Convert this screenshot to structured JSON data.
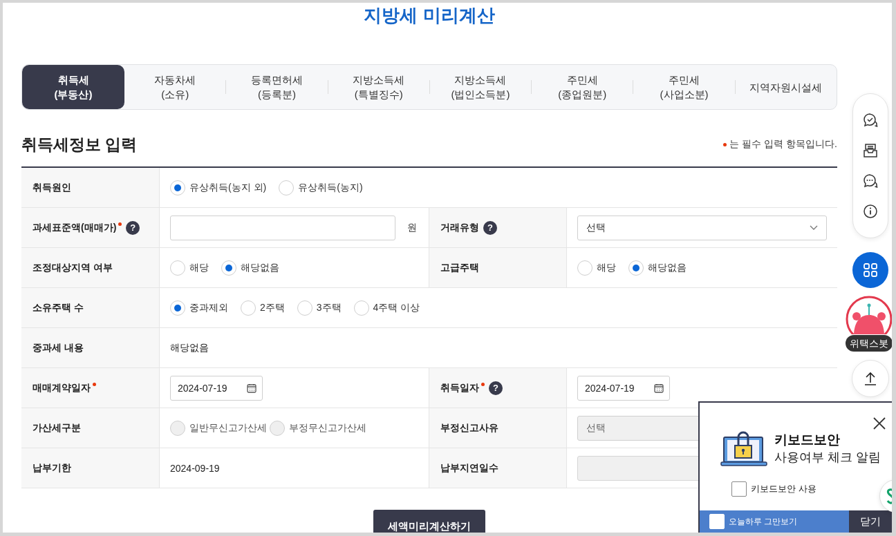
{
  "title": "지방세 미리계산",
  "tabs": [
    {
      "label": "취득세\n(부동산)",
      "selected": true
    },
    {
      "label": "자동차세\n(소유)",
      "selected": false
    },
    {
      "label": "등록면허세\n(등록분)",
      "selected": false
    },
    {
      "label": "지방소득세\n(특별징수)",
      "selected": false
    },
    {
      "label": "지방소득세\n(법인소득분)",
      "selected": false
    },
    {
      "label": "주민세\n(종업원분)",
      "selected": false
    },
    {
      "label": "주민세\n(사업소분)",
      "selected": false
    },
    {
      "label": "지역자원시설세",
      "selected": false
    }
  ],
  "section_title": "취득세정보 입력",
  "required_note": "는 필수 입력 항목입니다.",
  "rows": [
    {
      "fields": [
        {
          "label": "취득원인",
          "control": {
            "kind": "radio",
            "disabled": false,
            "options": [
              {
                "label": "유상취득(농지 외)",
                "selected": true
              },
              {
                "label": "유상취득(농지)",
                "selected": false
              }
            ]
          }
        }
      ]
    },
    {
      "fields": [
        {
          "label": "과세표준액(매매가)",
          "required": true,
          "help": "?",
          "control": {
            "kind": "input",
            "disabled": false,
            "unit": "원"
          }
        },
        {
          "label": "거래유형",
          "help": "?",
          "control": {
            "kind": "select",
            "disabled": false,
            "value": "선택"
          }
        }
      ]
    },
    {
      "fields": [
        {
          "label": "조정대상지역 여부",
          "control": {
            "kind": "radio",
            "disabled": false,
            "options": [
              {
                "label": "해당",
                "selected": false
              },
              {
                "label": "해당없음",
                "selected": true
              }
            ]
          }
        },
        {
          "label": "고급주택",
          "control": {
            "kind": "radio",
            "disabled": false,
            "options": [
              {
                "label": "해당",
                "selected": false
              },
              {
                "label": "해당없음",
                "selected": true
              }
            ]
          }
        }
      ]
    },
    {
      "fields": [
        {
          "label": "소유주택 수",
          "control": {
            "kind": "radio",
            "disabled": false,
            "options": [
              {
                "label": "중과제외",
                "selected": true
              },
              {
                "label": "2주택",
                "selected": false
              },
              {
                "label": "3주택",
                "selected": false
              },
              {
                "label": "4주택 이상",
                "selected": false
              }
            ]
          }
        }
      ]
    },
    {
      "fields": [
        {
          "label": "중과세 내용",
          "control": {
            "kind": "text",
            "value": "해당없음"
          }
        }
      ]
    },
    {
      "fields": [
        {
          "label": "매매계약일자",
          "required": true,
          "control": {
            "kind": "date",
            "value": "2024-07-19"
          }
        },
        {
          "label": "취득일자",
          "required": true,
          "help": "?",
          "control": {
            "kind": "date",
            "value": "2024-07-19"
          }
        }
      ]
    },
    {
      "fields": [
        {
          "label": "가산세구분",
          "control": {
            "kind": "radio",
            "disabled": true,
            "options": [
              {
                "label": "일반무신고가산세",
                "selected": false
              },
              {
                "label": "부정무신고가산세",
                "selected": false
              }
            ]
          }
        },
        {
          "label": "부정신고사유",
          "control": {
            "kind": "select",
            "disabled": true,
            "value": "선택"
          }
        }
      ]
    },
    {
      "fields": [
        {
          "label": "납부기한",
          "control": {
            "kind": "text",
            "value": "2024-09-19"
          }
        },
        {
          "label": "납부지연일수",
          "control": {
            "kind": "input",
            "disabled": true
          }
        }
      ]
    }
  ],
  "submit_button": "세액미리계산하기",
  "dock": {
    "bot_label": "위택스봇"
  },
  "popup": {
    "title": "키보드보안",
    "subtitle": "사용여부 체크 알림",
    "checkbox": {
      "label": "키보드보안 사용",
      "checked": false
    },
    "dismiss": {
      "label": "오늘하루 그만보기",
      "checked": false
    },
    "close_button": "닫기"
  }
}
